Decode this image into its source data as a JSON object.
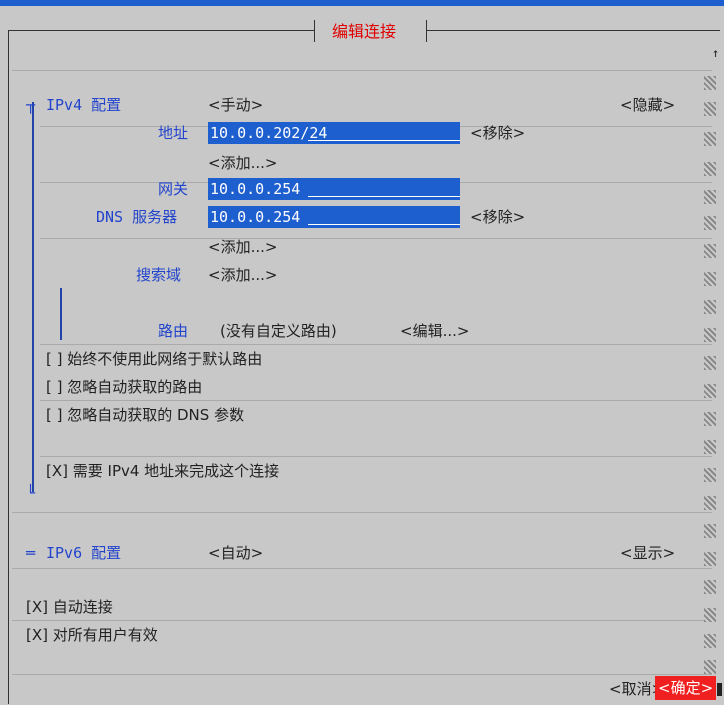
{
  "title": "编辑连接",
  "ipv4": {
    "label": "IPv4 配置",
    "mode": "<手动>",
    "toggle": "<隐藏>",
    "address_label": "地址",
    "address_value": "10.0.0.202/24",
    "remove1": "<移除>",
    "add1": "<添加...>",
    "gateway_label": "网关",
    "gateway_value": "10.0.0.254",
    "dns_label": "DNS 服务器",
    "dns_value": "10.0.0.254",
    "remove2": "<移除>",
    "add2": "<添加...>",
    "search_label": "搜索域",
    "add3": "<添加...>",
    "route_label": "路由",
    "route_value": "(没有自定义路由)",
    "route_edit": "<编辑...>",
    "chk1": "[ ] 始终不使用此网络于默认路由",
    "chk2": "[ ] 忽略自动获取的路由",
    "chk3": "[ ] 忽略自动获取的 DNS 参数",
    "chk4": "[X] 需要 IPv4 地址来完成这个连接"
  },
  "ipv6": {
    "label": "IPv6 配置",
    "mode": "<自动>",
    "toggle": "<显示>"
  },
  "auto_connect": "[X] 自动连接",
  "all_users": "[X] 对所有用户有效",
  "cancel": "<取消>",
  "ok": "<确定>",
  "scroll_up": "↑"
}
